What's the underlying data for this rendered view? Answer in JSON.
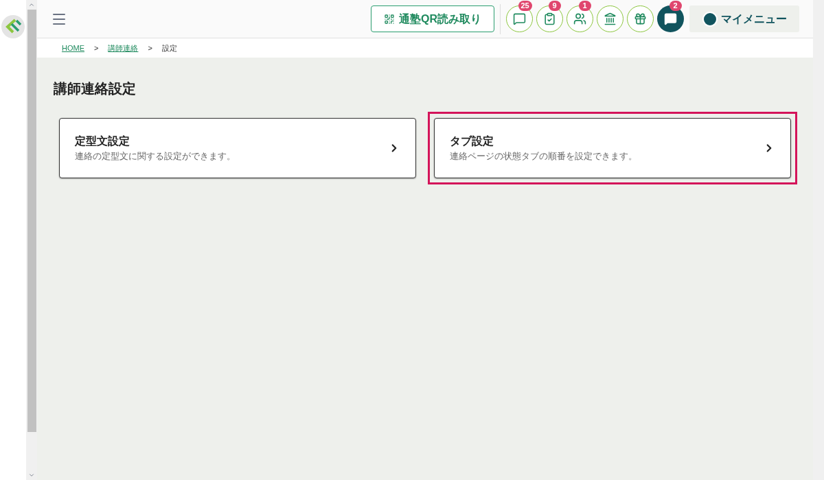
{
  "header": {
    "qr_button": "通塾QR読み取り",
    "icon_buttons": [
      {
        "kind": "chat",
        "badge": "25",
        "filled": false
      },
      {
        "kind": "task",
        "badge": "9",
        "filled": false
      },
      {
        "kind": "people",
        "badge": "1",
        "filled": false
      },
      {
        "kind": "school",
        "filled": false
      },
      {
        "kind": "gift",
        "filled": false
      },
      {
        "kind": "message",
        "badge": "2",
        "filled": true
      }
    ],
    "my_menu": "マイメニュー"
  },
  "breadcrumb": [
    {
      "label": "HOME",
      "link": true
    },
    {
      "label": ">",
      "link": false
    },
    {
      "label": "講師連絡",
      "link": true
    },
    {
      "label": ">",
      "link": false
    },
    {
      "label": "設定",
      "link": false
    }
  ],
  "page_title": "講師連絡設定",
  "cards": [
    {
      "title": "定型文設定",
      "description": "連絡の定型文に関する設定ができます。",
      "highlighted": false
    },
    {
      "title": "タブ設定",
      "description": "連絡ページの状態タブの順番を設定できます。",
      "highlighted": true
    }
  ]
}
